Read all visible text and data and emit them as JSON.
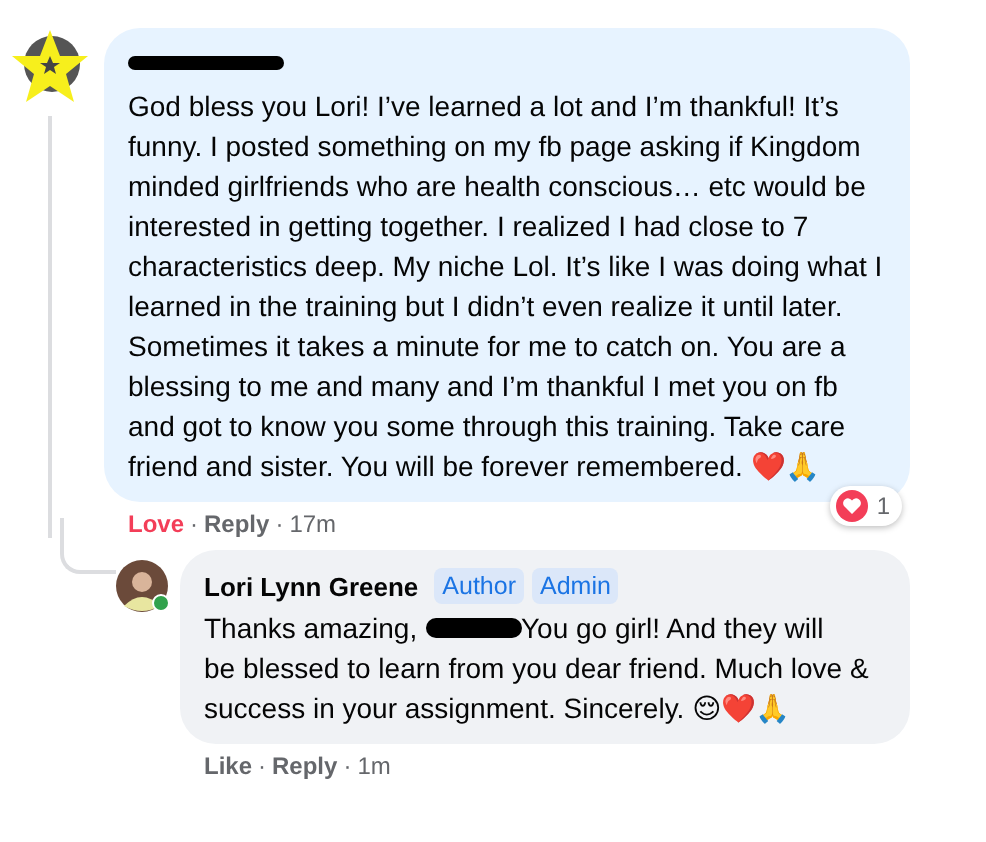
{
  "comment": {
    "author_redacted": true,
    "text": "God bless you Lori! I’ve learned a lot and I’m thankful! It’s funny. I posted something on my fb page asking if Kingdom minded girlfriends who are health conscious… etc would be interested in getting together. I realized I had close to 7 characteristics deep. My niche Lol. It’s like I was doing what I learned in the training but I didn’t even realize it until later. Sometimes it takes a minute for me to catch on. You are a blessing to me and many and I’m thankful I met you on fb and got to know you some through this training. Take care friend and sister. You will be forever remembered. ❤️🙏",
    "actions": [
      {
        "label": "Love",
        "selected": true
      },
      {
        "label": "Reply",
        "selected": false
      }
    ],
    "separator": "·",
    "time": "17m",
    "reaction_count": "1",
    "reply": {
      "author": "Lori Lynn Greene",
      "online": true,
      "badges": [
        "Author",
        "Admin"
      ],
      "text_before": "Thanks amazing,",
      "redacted": true,
      "text_line1": "You go girl! And they will",
      "text_rest": "be blessed to learn from you dear friend. Much love & success in your assignment. Sincerely. 😌❤️🙏",
      "actions": [
        {
          "label": "Like",
          "selected": false
        },
        {
          "label": "Reply",
          "selected": false
        }
      ],
      "time": "1m"
    }
  }
}
